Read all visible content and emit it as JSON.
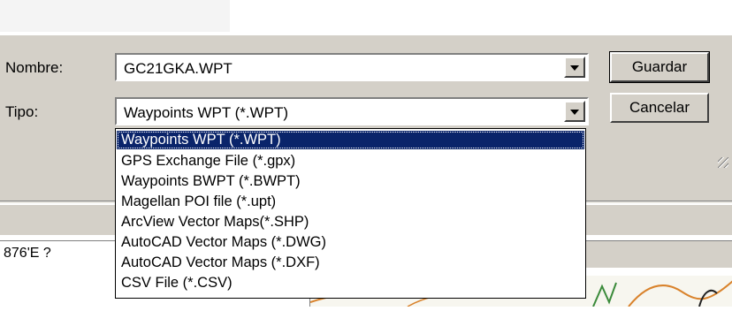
{
  "colors": {
    "dialog_face": "#d4d0c8",
    "selection": "#0a246a",
    "map_line_orange": "#d9822b",
    "map_line_green": "#3a8a3a"
  },
  "form": {
    "name_label": "Nombre:",
    "name_value": "GC21GKA.WPT",
    "type_label": "Tipo:",
    "type_value": "Waypoints WPT (*.WPT)",
    "arrow_icon": "chevron-down-icon"
  },
  "buttons": {
    "save": "Guardar",
    "cancel": "Cancelar"
  },
  "dropdown": {
    "selected_index": 0,
    "items": [
      "Waypoints WPT (*.WPT)",
      "GPS Exchange File (*.gpx)",
      "Waypoints BWPT (*.BWPT)",
      "Magellan POI file (*.upt)",
      "ArcView Vector Maps(*.SHP)",
      "AutoCAD Vector Maps (*.DWG)",
      "AutoCAD Vector Maps (*.DXF)",
      "CSV File (*.CSV)"
    ]
  },
  "status": {
    "coords_text": "876'E  ?"
  }
}
